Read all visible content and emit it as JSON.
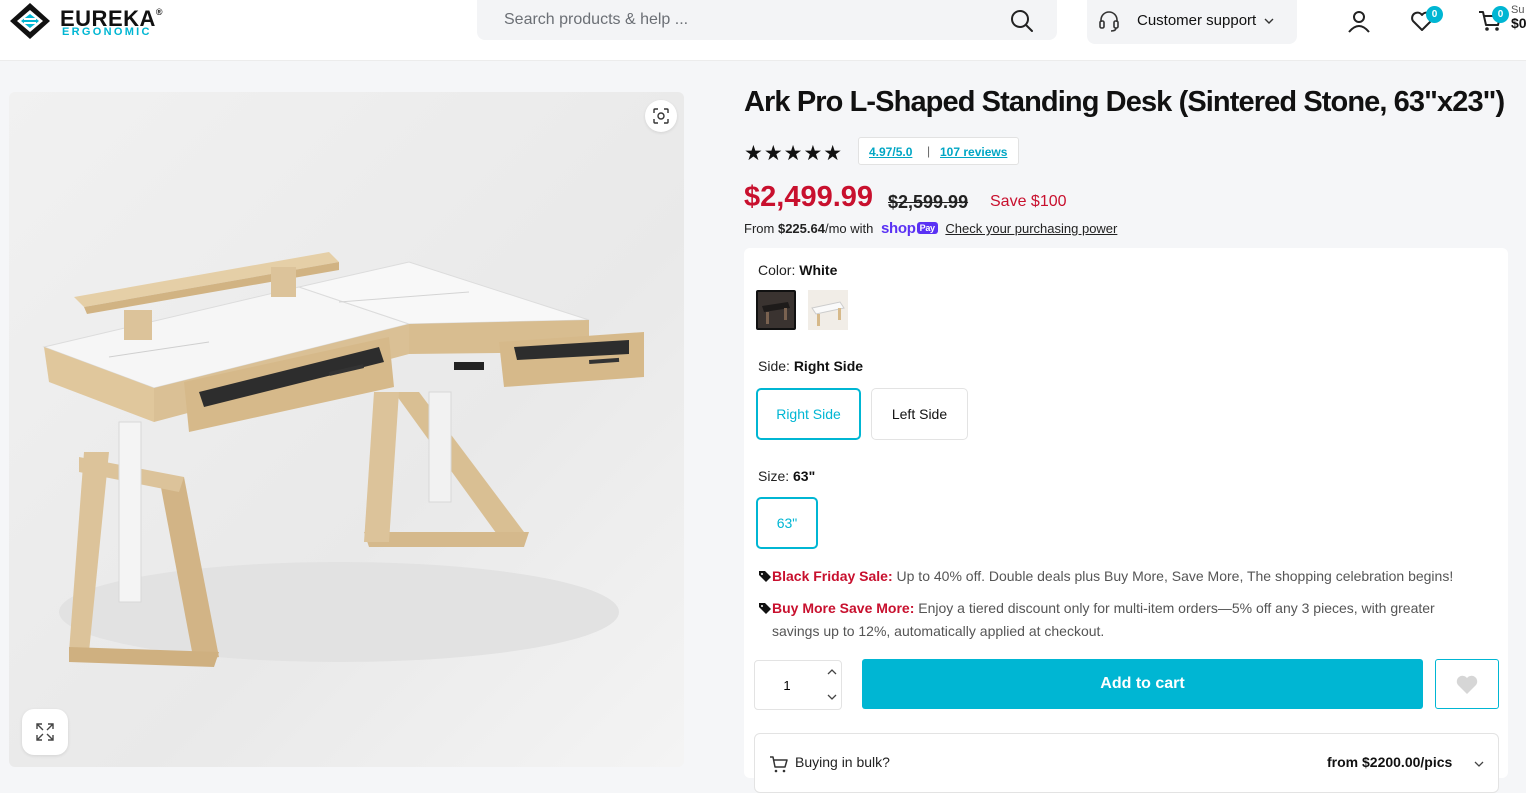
{
  "header": {
    "logo_text": "EUREKA",
    "logo_registered": "®",
    "logo_sub": "ERGONOMIC",
    "search_placeholder": "Search products & help ...",
    "support_label": "Customer support",
    "wishlist_count": "0",
    "cart_count": "0",
    "cart_label": "Su",
    "cart_amount": "$0"
  },
  "product": {
    "title": "Ark Pro L-Shaped Standing Desk (Sintered Stone, 63\"x23\")",
    "stars": "★★★★★",
    "rating": "4.97/5.0",
    "rating_sep": "|",
    "reviews": "107 reviews",
    "price": "$2,499.99",
    "compare_price": "$2,599.99",
    "save": "Save $100",
    "installment_prefix": "From",
    "installment_amount": "$225.64",
    "installment_suffix": "/mo with",
    "shop_logo": "shop",
    "shop_pay": "Pay",
    "purchasing_power": "Check your purchasing power"
  },
  "options": {
    "color_label": "Color:",
    "color_value": "White",
    "side_label": "Side:",
    "side_value": "Right Side",
    "side_options": [
      "Right Side",
      "Left Side"
    ],
    "size_label": "Size:",
    "size_value": "63\"",
    "size_options": [
      "63\""
    ]
  },
  "promos": [
    {
      "head": "Black Friday Sale:",
      "text": "Up to 40% off. Double deals plus Buy More, Save More, The shopping celebration begins!"
    },
    {
      "head": "Buy More Save More:",
      "text": "Enjoy a tiered discount only for multi-item orders—5% off any 3 pieces, with greater",
      "text2": "savings up to 12%, automatically applied at checkout."
    }
  ],
  "cart": {
    "quantity": "1",
    "add_label": "Add to cart"
  },
  "bulk": {
    "label": "Buying in bulk?",
    "price": "from $2200.00/pics"
  },
  "colors": {
    "accent": "#00b6d3",
    "sale": "#c8102e",
    "shop_pay": "#5a31f4"
  }
}
